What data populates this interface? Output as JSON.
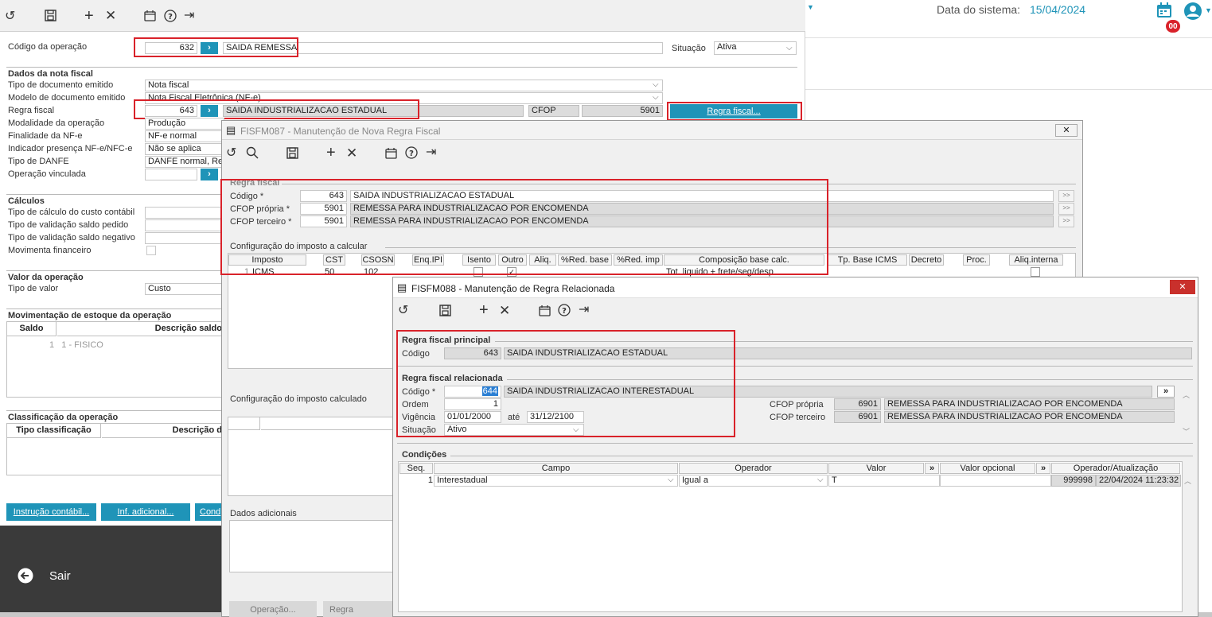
{
  "top": {
    "date_label": "Data do sistema:",
    "date_value": "15/04/2024",
    "badge": "00"
  },
  "main": {
    "codigo_operacao_label": "Código da operação",
    "codigo_operacao_value": "632",
    "codigo_operacao_desc": "SAIDA REMESSA",
    "situacao_label": "Situação",
    "situacao_value": "Ativa",
    "dados_nota_title": "Dados da nota fiscal",
    "fields": [
      {
        "label": "Tipo de documento emitido",
        "value": "Nota fiscal"
      },
      {
        "label": "Modelo de documento emitido",
        "value": "Nota Fiscal Eletrônica (NF-e)"
      },
      {
        "label": "Regra fiscal",
        "value": "643"
      },
      {
        "label": "Modalidade da operação",
        "value": "Produção"
      },
      {
        "label": "Finalidade da NF-e",
        "value": "NF-e normal"
      },
      {
        "label": "Indicador presença NF-e/NFC-e",
        "value": "Não se aplica"
      },
      {
        "label": "Tipo de DANFE",
        "value": "DANFE normal, Ret"
      },
      {
        "label": "Operação vinculada",
        "value": ""
      }
    ],
    "regra_desc": "SAIDA INDUSTRIALIZACAO ESTADUAL",
    "cfop_label": "CFOP",
    "cfop_value": "5901",
    "regra_fiscal_button": "Regra fiscal...",
    "calculos_title": "Cálculos",
    "calculos": [
      "Tipo de cálculo do custo contábil",
      "Tipo de validação saldo pedido",
      "Tipo de validação saldo negativo",
      "Movimenta financeiro"
    ],
    "valor_title": "Valor da operação",
    "tipo_valor_label": "Tipo de valor",
    "tipo_valor_value": "Custo",
    "mov_title": "Movimentação de estoque da operação",
    "mov_col_saldo": "Saldo",
    "mov_col_desc": "Descrição saldo",
    "mov_row": "1   1 - FISICO",
    "class_title": "Classificação da operação",
    "class_col_tipo": "Tipo classificação",
    "class_col_desc": "Descrição d",
    "btn_instrucao": "Instrução contábil...",
    "btn_inf": "Inf. adicional...",
    "btn_cond": "Cond",
    "sair": "Sair"
  },
  "fisfm087": {
    "title": "FISFM087 - Manutenção de Nova Regra Fiscal",
    "regra_title": "Regra fiscal",
    "rows": [
      {
        "label": "Código *",
        "code": "643",
        "desc": "SAIDA INDUSTRIALIZACAO ESTADUAL"
      },
      {
        "label": "CFOP própria *",
        "code": "5901",
        "desc": "REMESSA PARA INDUSTRIALIZACAO POR ENCOMENDA"
      },
      {
        "label": "CFOP terceiro *",
        "code": "5901",
        "desc": "REMESSA PARA INDUSTRIALIZACAO POR ENCOMENDA"
      }
    ],
    "config_title": "Configuração do imposto a calcular",
    "headers": [
      "Imposto",
      "CST",
      "CSOSN",
      "Enq.IPI",
      "Isento",
      "Outro",
      "Aliq.",
      "%Red. base",
      "%Red. imp",
      "Composição base calc.",
      "Tp. Base ICMS",
      "Decreto",
      "Proc.",
      "Aliq.interna"
    ],
    "row1": {
      "seq": "1",
      "imposto": "ICMS",
      "cst": "50",
      "csosn": "102",
      "comp": "Tot. liquido + frete/seg/desp"
    },
    "calc_title": "Configuração do imposto calculado",
    "dados_title": "Dados adicionais",
    "btn_operacao": "Operação...",
    "btn_regra_rel": "Regra relacionad"
  },
  "fisfm088": {
    "title": "FISFM088 - Manutenção de Regra Relacionada",
    "principal_title": "Regra fiscal principal",
    "principal_label": "Código",
    "principal_code": "643",
    "principal_desc": "SAIDA INDUSTRIALIZACAO ESTADUAL",
    "relacionada_title": "Regra fiscal relacionada",
    "codigo_label": "Código *",
    "codigo_value": "644",
    "codigo_desc": "SAIDA INDUSTRIALIZACAO INTERESTADUAL",
    "ordem_label": "Ordem",
    "ordem_value": "1",
    "vigencia_label": "Vigência",
    "vigencia_de": "01/01/2000",
    "ate_label": "até",
    "vigencia_ate": "31/12/2100",
    "situacao_label": "Situação",
    "situacao_value": "Ativo",
    "cfop_propria_label": "CFOP própria",
    "cfop_propria_code": "6901",
    "cfop_propria_desc": "REMESSA PARA INDUSTRIALIZACAO POR ENCOMENDA",
    "cfop_terceiro_label": "CFOP terceiro",
    "cfop_terceiro_code": "6901",
    "cfop_terceiro_desc": "REMESSA PARA INDUSTRIALIZACAO POR ENCOMENDA",
    "condicoes_title": "Condições",
    "headers": [
      "Seq.",
      "Campo",
      "Operador",
      "Valor",
      "Valor opcional",
      "Operador/Atualização"
    ],
    "row": {
      "seq": "1",
      "campo": "Interestadual",
      "operador": "Igual a",
      "valor": "T",
      "user": "999998",
      "datetime": "22/04/2024 11:23:32"
    }
  }
}
